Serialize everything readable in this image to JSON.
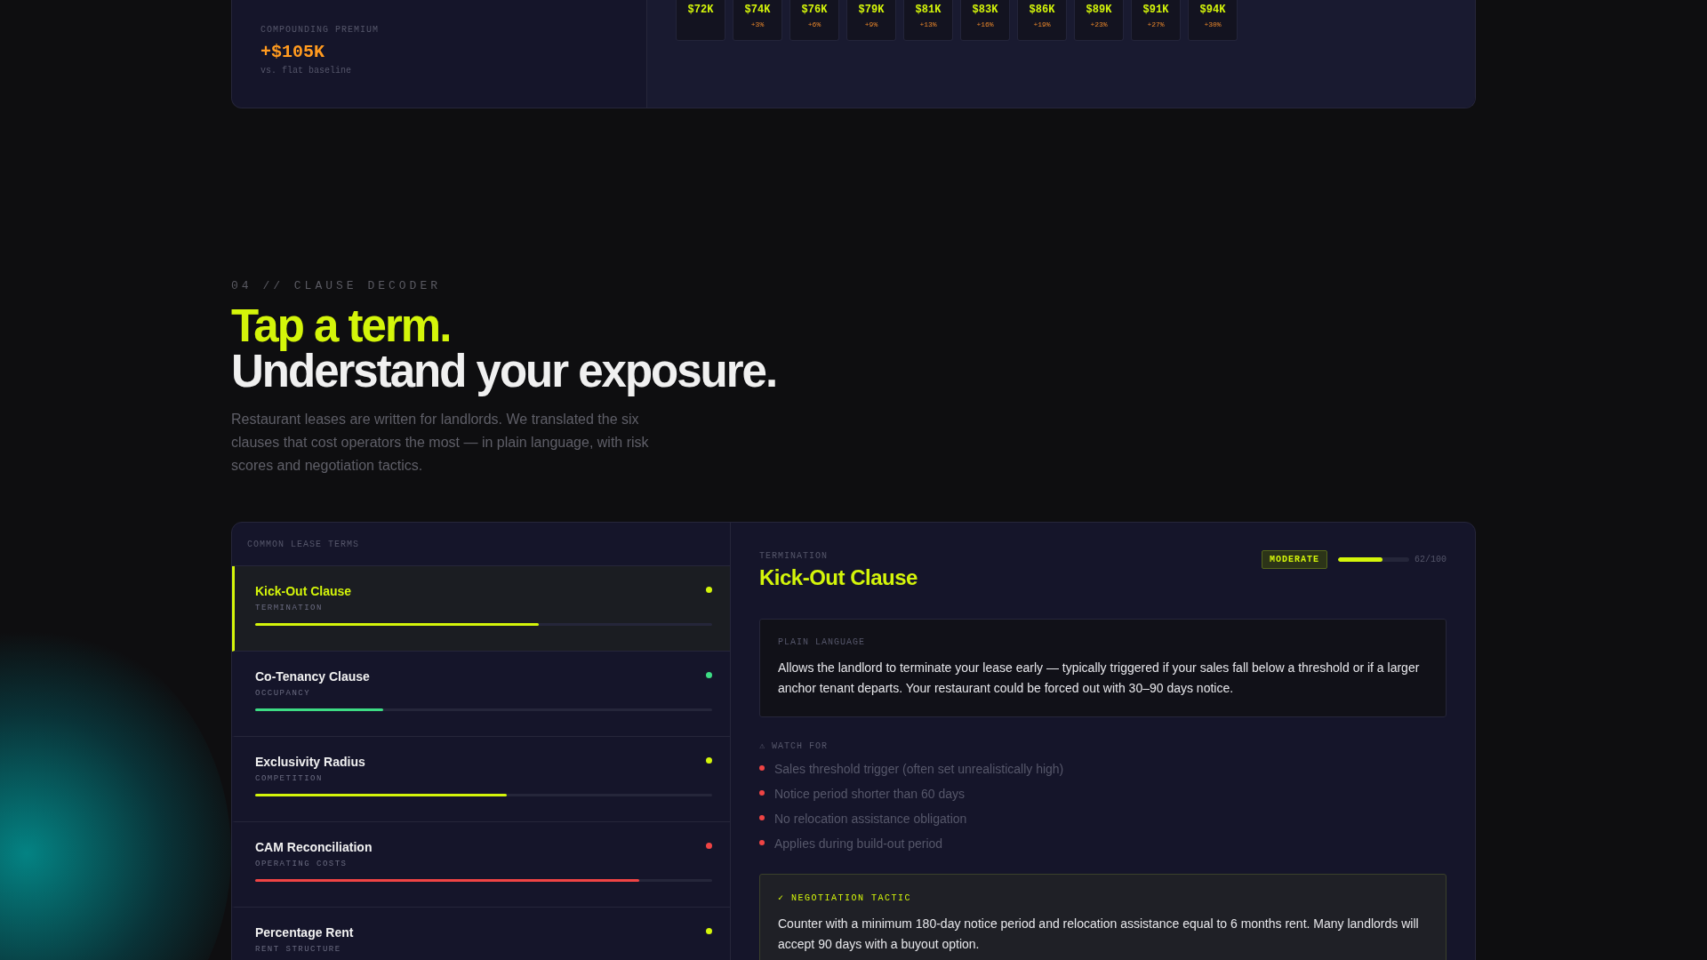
{
  "summary_card": {
    "premium_label": "COMPOUNDING PREMIUM",
    "premium_value": "+$105K",
    "premium_note": "vs. flat baseline",
    "projection_cells": [
      {
        "value": "$72K"
      },
      {
        "value": "$74K",
        "change": "+3%"
      },
      {
        "value": "$76K",
        "change": "+6%"
      },
      {
        "value": "$79K",
        "change": "+9%"
      },
      {
        "value": "$81K",
        "change": "+13%"
      },
      {
        "value": "$83K",
        "change": "+16%"
      },
      {
        "value": "$86K",
        "change": "+19%"
      },
      {
        "value": "$89K",
        "change": "+23%"
      },
      {
        "value": "$91K",
        "change": "+27%"
      },
      {
        "value": "$94K",
        "change": "+30%"
      }
    ]
  },
  "section": {
    "eyebrow": "04 // CLAUSE DECODER",
    "headline_accent": "Tap a term.",
    "headline": "Understand your exposure.",
    "intro": "Restaurant leases are written for landlords. We translated the six clauses that cost operators the most — in plain language, with risk scores and negotiation tactics."
  },
  "terms_list": {
    "heading": "COMMON LEASE TERMS",
    "items": [
      {
        "name": "Kick-Out Clause",
        "category": "TERMINATION",
        "selected": true,
        "color": "#d4f50a",
        "level": 0.62
      },
      {
        "name": "Co-Tenancy Clause",
        "category": "OCCUPANCY",
        "selected": false,
        "color": "#3ddc84",
        "level": 0.28
      },
      {
        "name": "Exclusivity Radius",
        "category": "COMPETITION",
        "selected": false,
        "color": "#d4f50a",
        "level": 0.55
      },
      {
        "name": "CAM Reconciliation",
        "category": "OPERATING COSTS",
        "selected": false,
        "color": "#ef4444",
        "level": 0.84
      },
      {
        "name": "Percentage Rent",
        "category": "RENT STRUCTURE",
        "selected": false,
        "color": "#d4f50a"
      }
    ]
  },
  "detail": {
    "category": "TERMINATION",
    "title": "Kick-Out Clause",
    "risk_badge": "MODERATE",
    "risk_meter": {
      "level": 0.62
    },
    "risk_score": "62/100",
    "plain_label": "PLAIN LANGUAGE",
    "plain_text": "Allows the landlord to terminate your lease early — typically triggered if your sales fall below a threshold or if a larger anchor tenant departs. Your restaurant could be forced out with 30–90 days notice.",
    "watch_label": "⚠ WATCH FOR",
    "watch_items": [
      "Sales threshold trigger (often set unrealistically high)",
      "Notice period shorter than 60 days",
      "No relocation assistance obligation",
      "Applies during build-out period"
    ],
    "tactic_label": "✓ NEGOTIATION TACTIC",
    "tactic_text": "Counter with a minimum 180-day notice period and relocation assistance equal to 6 months rent. Many landlords will accept 90 days with a buyout option."
  }
}
